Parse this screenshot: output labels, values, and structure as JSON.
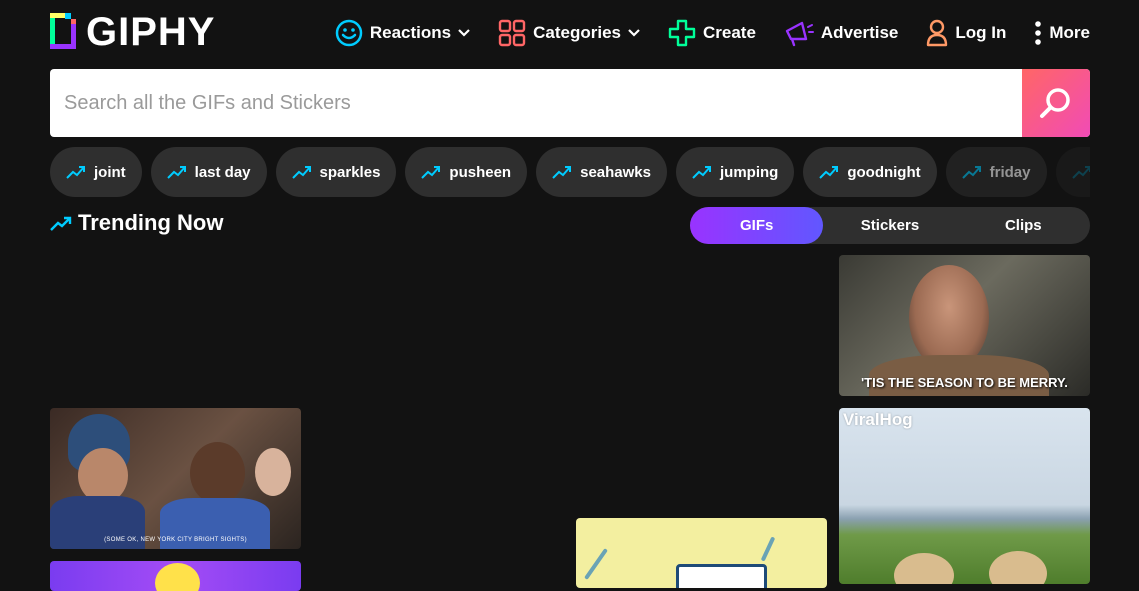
{
  "header": {
    "logo_text": "GIPHY",
    "nav": [
      {
        "label": "Reactions",
        "icon": "smiley-icon",
        "has_dropdown": true
      },
      {
        "label": "Categories",
        "icon": "grid-icon",
        "has_dropdown": true
      },
      {
        "label": "Create",
        "icon": "plus-icon",
        "has_dropdown": false
      },
      {
        "label": "Advertise",
        "icon": "megaphone-icon",
        "has_dropdown": false
      },
      {
        "label": "Log In",
        "icon": "user-icon",
        "has_dropdown": false
      },
      {
        "label": "More",
        "icon": "kebab-icon",
        "has_dropdown": false
      }
    ]
  },
  "search": {
    "placeholder": "Search all the GIFs and Stickers",
    "value": ""
  },
  "trending_pills": [
    "joint",
    "last day",
    "sparkles",
    "pusheen",
    "seahawks",
    "jumping",
    "goodnight",
    "friday"
  ],
  "trending": {
    "title": "Trending Now",
    "tabs": [
      {
        "label": "GIFs",
        "active": true
      },
      {
        "label": "Stickers",
        "active": false
      },
      {
        "label": "Clips",
        "active": false
      }
    ]
  },
  "gifs": {
    "card1_caption": "'TIS THE SEASON TO BE MERRY.",
    "card2_caption": "(SOME OK, NEW YORK CITY BRIGHT SIGHTS)",
    "card3_watermark": "ViralHog"
  },
  "colors": {
    "background": "#121212",
    "pill": "#2f2f2f",
    "accent_purple": "#9933ff",
    "accent_pink": "#f14bb6"
  }
}
